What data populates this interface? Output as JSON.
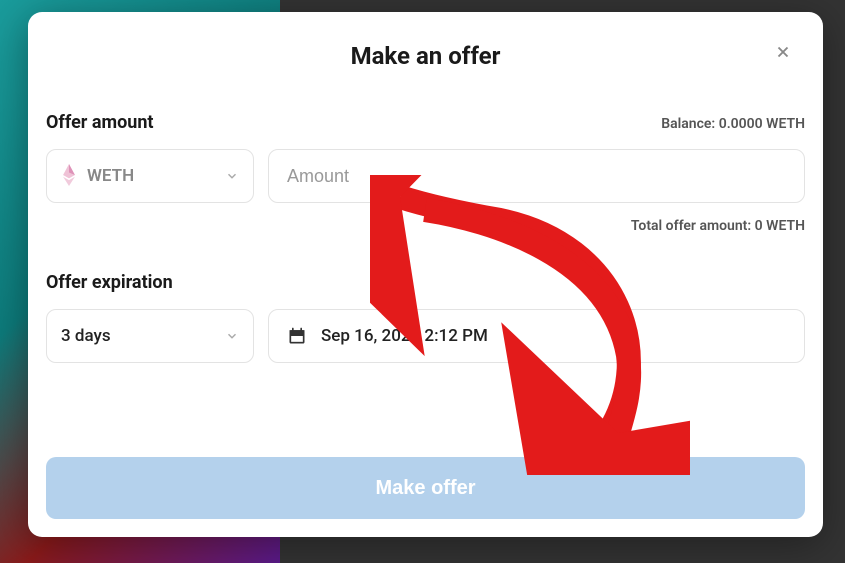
{
  "modal": {
    "title": "Make an offer",
    "offer_amount_label": "Offer amount",
    "balance_text": "Balance: 0.0000 WETH",
    "currency": "WETH",
    "amount_placeholder": "Amount",
    "total_text": "Total offer amount: 0 WETH",
    "expiration_label": "Offer expiration",
    "duration": "3 days",
    "date": "Sep 16, 2022 2:12 PM",
    "submit_label": "Make offer"
  }
}
